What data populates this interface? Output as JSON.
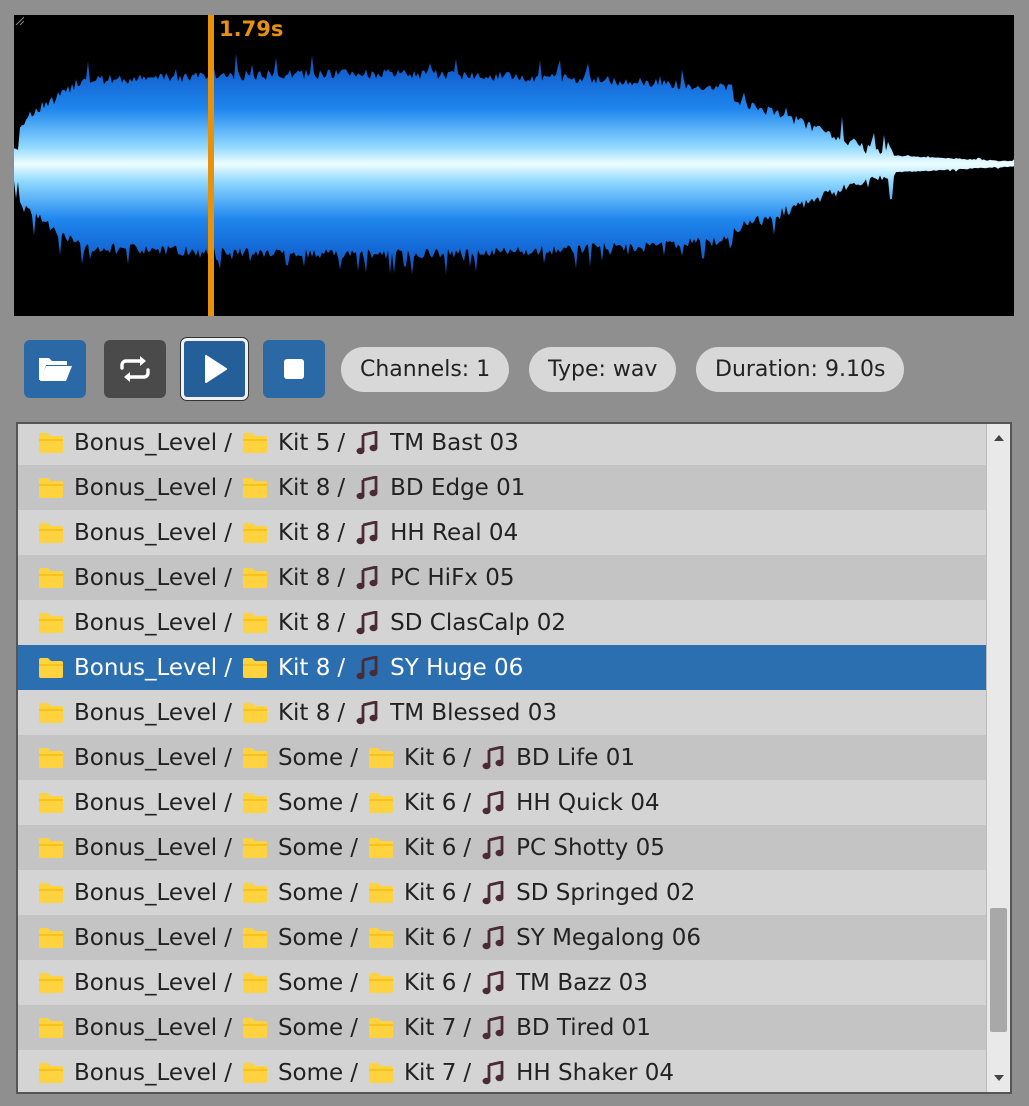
{
  "waveform": {
    "cursor_label": "1.79s",
    "cursor_position_fraction": 0.197,
    "colors": {
      "wave_outer": "#1f6fe0",
      "wave_inner": "#e8fbff",
      "cursor": "#e8920c",
      "background": "#000000"
    }
  },
  "toolbar": {
    "open_icon": "folder-open-icon",
    "loop_icon": "repeat-icon",
    "play_icon": "play-icon",
    "stop_icon": "stop-icon",
    "channels_label": "Channels: 1",
    "type_label": "Type: wav",
    "duration_label": "Duration: 9.10s"
  },
  "file_list": {
    "selected_index": 5,
    "rows": [
      {
        "path": [
          "Bonus_Level",
          "Kit 5"
        ],
        "name": "TM Bast 03"
      },
      {
        "path": [
          "Bonus_Level",
          "Kit 8"
        ],
        "name": "BD Edge 01"
      },
      {
        "path": [
          "Bonus_Level",
          "Kit 8"
        ],
        "name": "HH Real 04"
      },
      {
        "path": [
          "Bonus_Level",
          "Kit 8"
        ],
        "name": "PC HiFx 05"
      },
      {
        "path": [
          "Bonus_Level",
          "Kit 8"
        ],
        "name": "SD ClasCalp 02"
      },
      {
        "path": [
          "Bonus_Level",
          "Kit 8"
        ],
        "name": "SY Huge 06"
      },
      {
        "path": [
          "Bonus_Level",
          "Kit 8"
        ],
        "name": "TM Blessed 03"
      },
      {
        "path": [
          "Bonus_Level",
          "Some",
          "Kit 6"
        ],
        "name": "BD Life 01"
      },
      {
        "path": [
          "Bonus_Level",
          "Some",
          "Kit 6"
        ],
        "name": "HH Quick 04"
      },
      {
        "path": [
          "Bonus_Level",
          "Some",
          "Kit 6"
        ],
        "name": "PC Shotty 05"
      },
      {
        "path": [
          "Bonus_Level",
          "Some",
          "Kit 6"
        ],
        "name": "SD Springed 02"
      },
      {
        "path": [
          "Bonus_Level",
          "Some",
          "Kit 6"
        ],
        "name": "SY Megalong 06"
      },
      {
        "path": [
          "Bonus_Level",
          "Some",
          "Kit 6"
        ],
        "name": "TM Bazz 03"
      },
      {
        "path": [
          "Bonus_Level",
          "Some",
          "Kit 7"
        ],
        "name": "BD Tired 01"
      },
      {
        "path": [
          "Bonus_Level",
          "Some",
          "Kit 7"
        ],
        "name": "HH Shaker 04"
      }
    ],
    "separator": "/",
    "folder_icon": "folder-icon",
    "file_icon": "music-note-icon",
    "colors": {
      "selected": "#2c6fb0",
      "folder": "#ffd23f",
      "note": "#4a2a35"
    }
  },
  "scrollbar": {
    "up_icon": "scroll-up-arrow-icon",
    "down_icon": "scroll-down-arrow-icon"
  }
}
